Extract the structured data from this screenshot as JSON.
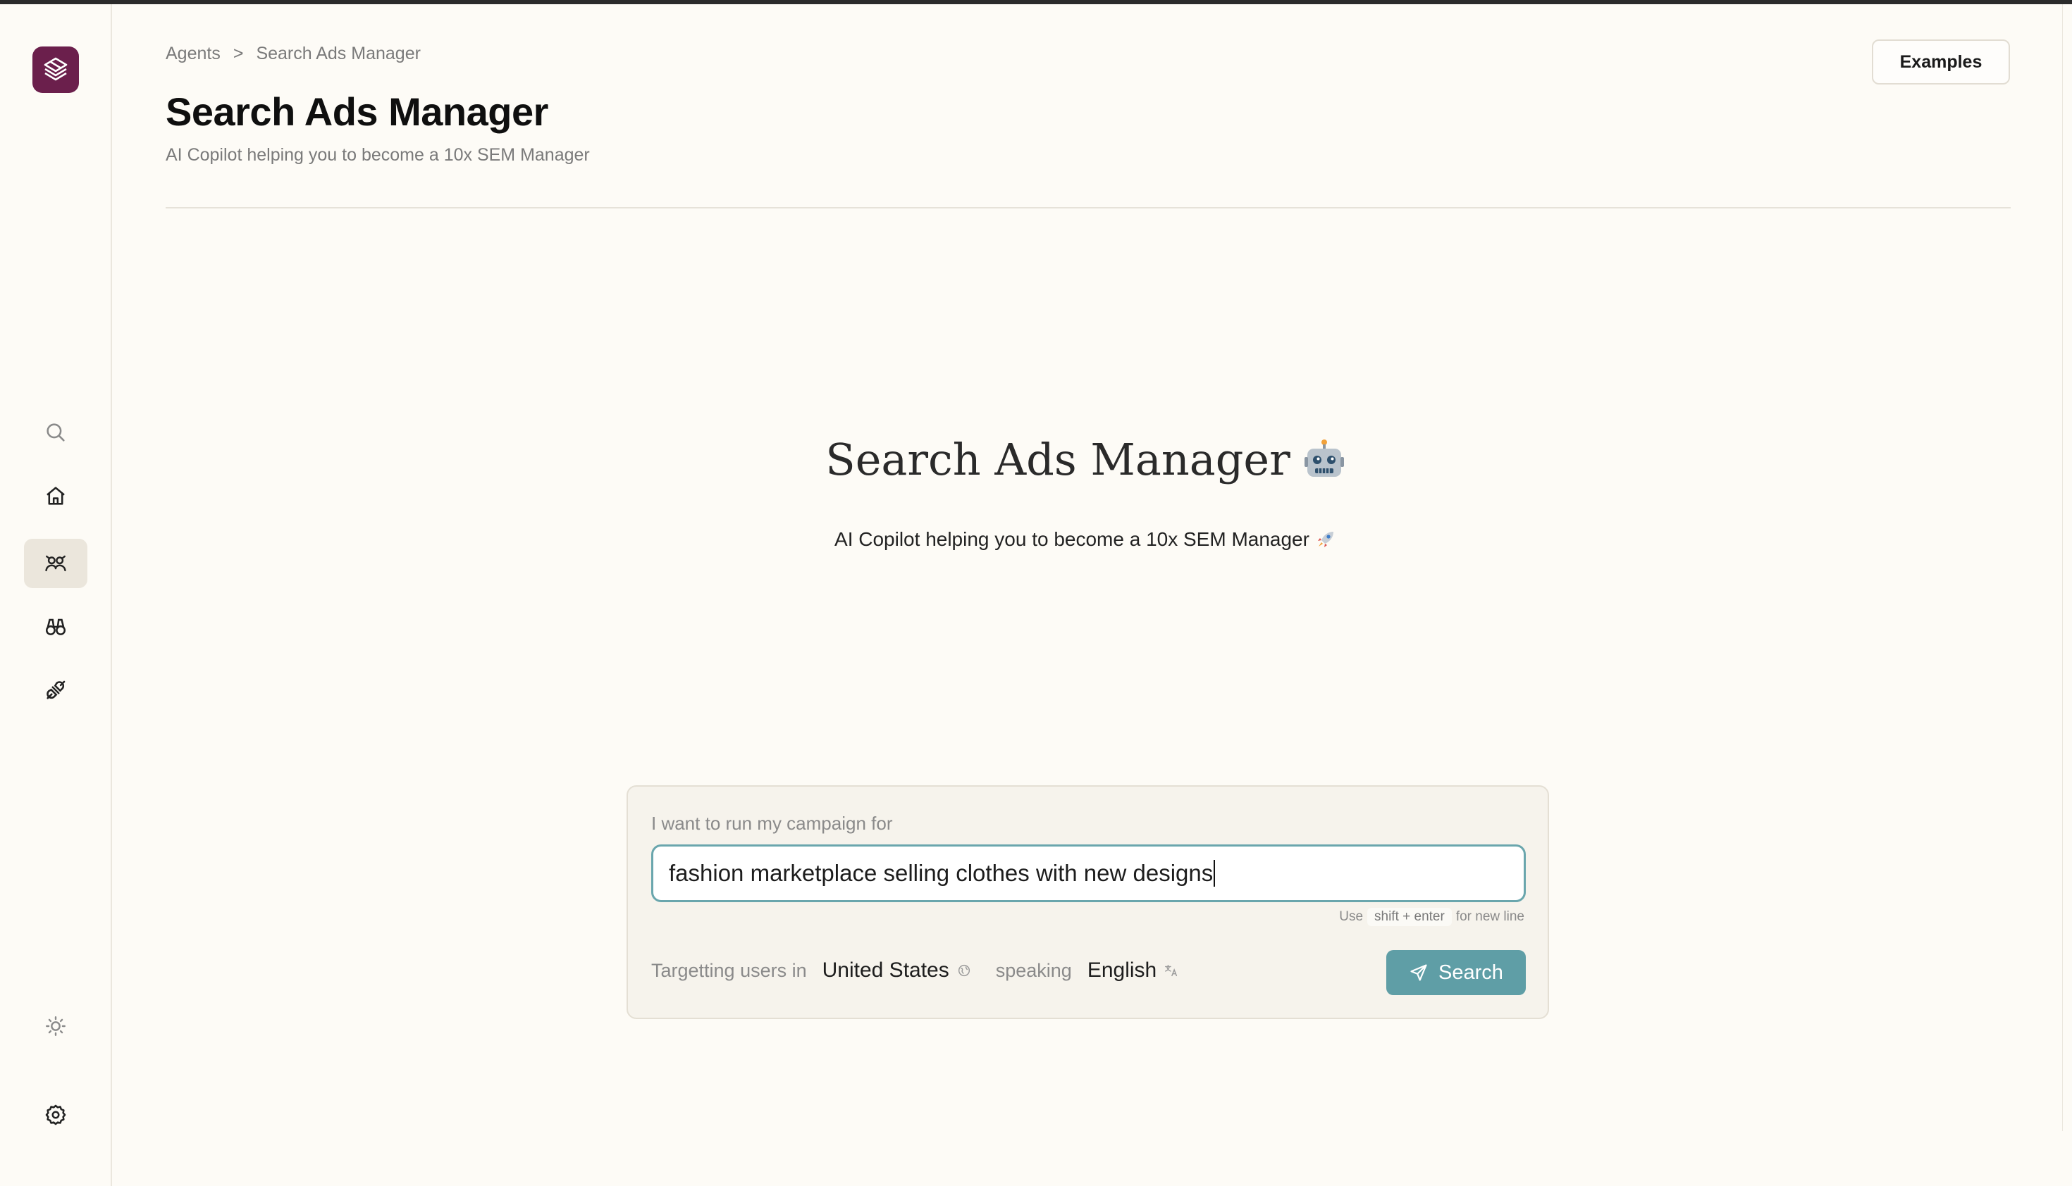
{
  "breadcrumb": {
    "items": [
      "Agents",
      "Search Ads Manager"
    ],
    "separator": ">"
  },
  "header": {
    "title": "Search Ads Manager",
    "subtitle": "AI Copilot helping you to become a 10x SEM Manager",
    "examples_label": "Examples"
  },
  "hero": {
    "title": "Search Ads Manager",
    "subtitle": "AI Copilot helping you to become a 10x SEM Manager"
  },
  "form": {
    "campaign_label": "I want to run my campaign for",
    "campaign_value": "fashion marketplace selling clothes with new designs",
    "hint_use": "Use",
    "hint_keys": "shift + enter",
    "hint_suffix": "for new line",
    "targeting_label": "Targetting users in",
    "country": "United States",
    "speaking_label": "speaking",
    "language": "English",
    "search_label": "Search"
  },
  "sidebar": {
    "items": [
      {
        "icon": "search-icon"
      },
      {
        "icon": "home-icon"
      },
      {
        "icon": "agents-icon",
        "active": true
      },
      {
        "icon": "binoculars-icon"
      },
      {
        "icon": "plug-icon"
      },
      {
        "icon": "sun-icon"
      },
      {
        "icon": "gear-icon"
      }
    ]
  },
  "colors": {
    "logo_bg": "#6b1f4c",
    "accent": "#5f9ea6",
    "input_border": "#6aa6ad",
    "background": "#fdfbf6"
  }
}
